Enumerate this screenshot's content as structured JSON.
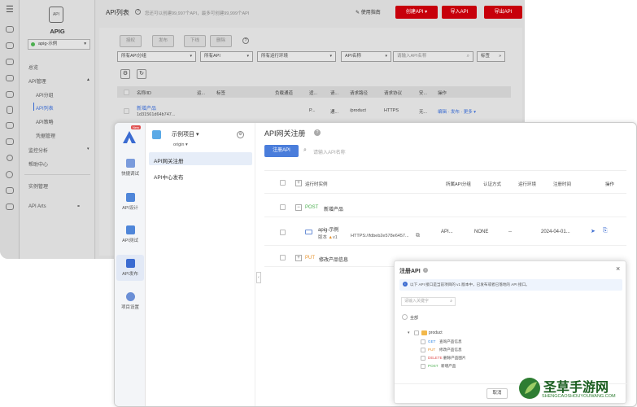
{
  "back": {
    "sidebar": {
      "app_title": "APIG",
      "instance": "apig-示例",
      "items": [
        {
          "label": "总览"
        },
        {
          "label": "API管理"
        },
        {
          "label": "API分组"
        },
        {
          "label": "API列表"
        },
        {
          "label": "API策略"
        },
        {
          "label": "凭据管理"
        },
        {
          "label": "监控分析"
        },
        {
          "label": "帮助中心"
        },
        {
          "label": "实例管理"
        },
        {
          "label": "API Arts"
        }
      ]
    },
    "header": {
      "title": "API列表",
      "quota_text": "您还可以创建99,997个API，最多可创建99,999个API",
      "guide_link": "使用指南",
      "create_btn": "创建API",
      "import_btn": "导入API",
      "export_btn": "导出API"
    },
    "actions": {
      "authorize": "授权",
      "publish": "发布",
      "offline": "下线",
      "delete": "删除"
    },
    "filters": {
      "group": "所有API分组",
      "api": "所有API",
      "env": "所有运行环境",
      "field": "API名称",
      "search_placeholder": "请输入API名称",
      "tag": "标签"
    },
    "table": {
      "columns": [
        "名称/ID",
        "运...",
        "标签",
        "负载通道",
        "适...",
        "请...",
        "请求路径",
        "请求协议",
        "安...",
        "操作"
      ],
      "row": {
        "name": "新增产品",
        "id": "1d31561d64b747...",
        "col5": "P...",
        "col6": "通...",
        "path": "/product",
        "protocol": "HTTPS",
        "col9": "无...",
        "ops": "编辑 · 发布 · 更多"
      }
    }
  },
  "front": {
    "new_badge": "New",
    "iconbar": [
      {
        "label": "快捷调试"
      },
      {
        "label": "API设计"
      },
      {
        "label": "API测试"
      },
      {
        "label": "API发布"
      },
      {
        "label": "项目设置"
      }
    ],
    "project": {
      "name": "示例项目",
      "branch": "origin"
    },
    "nav": [
      {
        "label": "API网关注册"
      },
      {
        "label": "API中心发布"
      }
    ],
    "main": {
      "title": "API网关注册",
      "register_btn": "注册API",
      "search_placeholder": "请输入API名称",
      "columns": {
        "instance": "运行时实例",
        "group": "所属API分组",
        "auth": "认证方式",
        "env": "运行环境",
        "time": "注册时间",
        "ops": "操作"
      },
      "rows": [
        {
          "method": "POST",
          "name": "新增产品"
        },
        {
          "instance_name": "apig-示例",
          "version_label": "版本",
          "version_value": "v1",
          "url": "HTTPS://fdbeb2e578e6457...",
          "group": "API...",
          "auth": "NONE",
          "env": "--",
          "time": "2024-04-01..."
        },
        {
          "method": "PUT",
          "name": "修改产品信息"
        }
      ]
    },
    "dialog": {
      "title": "注册API",
      "info": "以下 API 接口是当前项目的 v1 版本中，已发布或者已落地的 API 接口。",
      "search_placeholder": "请输入关键字",
      "select_all": "全部",
      "folder": "product",
      "apis": [
        {
          "method": "GET",
          "name": "查询产品信息"
        },
        {
          "method": "PUT",
          "name": "修改产品信息"
        },
        {
          "method": "DELETE",
          "name": "删除产品图片"
        },
        {
          "method": "POST",
          "name": "新增产品"
        }
      ],
      "cancel": "取消"
    }
  },
  "watermark": {
    "title": "圣草手游网",
    "url": "SHENGCAOSHOUYOUWANG.COM"
  },
  "colors": {
    "brand_red": "#c7000b",
    "link_blue": "#3a6bd1",
    "post": "#4caf50",
    "put": "#e6912a",
    "delete": "#e05050",
    "get": "#3a8ee6"
  }
}
